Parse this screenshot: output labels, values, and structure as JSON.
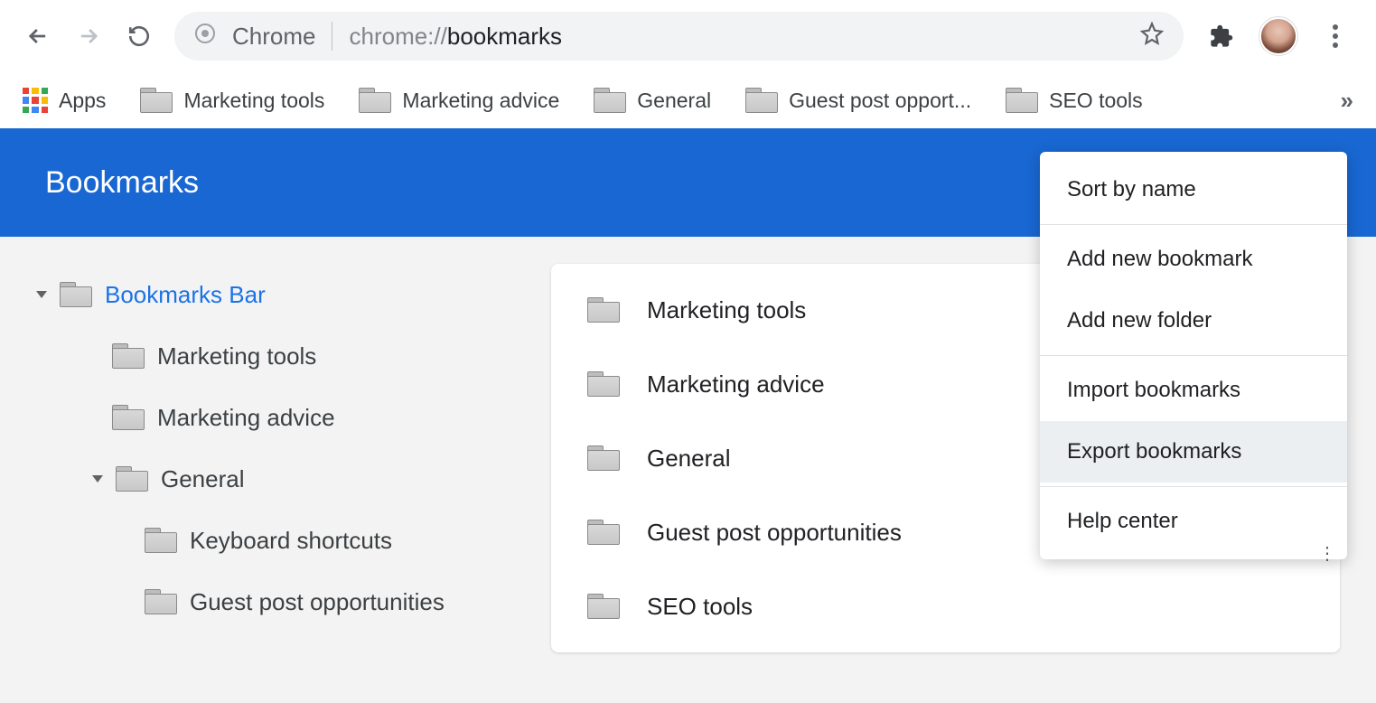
{
  "browser": {
    "chrome_label": "Chrome",
    "url_scheme": "chrome://",
    "url_path": "bookmarks"
  },
  "bookmarks_bar": {
    "apps_label": "Apps",
    "items": [
      {
        "label": "Marketing tools"
      },
      {
        "label": "Marketing advice"
      },
      {
        "label": "General"
      },
      {
        "label": "Guest post opport..."
      },
      {
        "label": "SEO tools"
      }
    ]
  },
  "page": {
    "title": "Bookmarks"
  },
  "sidebar": {
    "root_label": "Bookmarks Bar",
    "children": [
      {
        "label": "Marketing tools"
      },
      {
        "label": "Marketing advice"
      },
      {
        "label": "General",
        "expanded": true,
        "children": [
          {
            "label": "Keyboard shortcuts"
          },
          {
            "label": "Guest post opportunities"
          }
        ]
      }
    ]
  },
  "main_list": [
    {
      "label": "Marketing tools"
    },
    {
      "label": "Marketing advice"
    },
    {
      "label": "General"
    },
    {
      "label": "Guest post opportunities"
    },
    {
      "label": "SEO tools"
    }
  ],
  "menu": {
    "sort": "Sort by name",
    "add_bookmark": "Add new bookmark",
    "add_folder": "Add new folder",
    "import": "Import bookmarks",
    "export": "Export bookmarks",
    "help": "Help center"
  }
}
